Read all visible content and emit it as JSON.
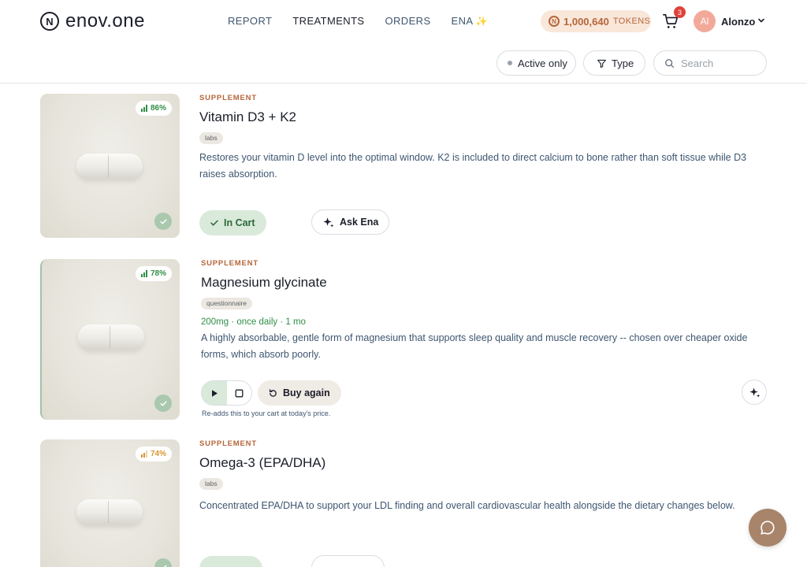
{
  "header": {
    "logo_text": "enov.one",
    "nav": [
      "REPORT",
      "TREATMENTS",
      "ORDERS",
      "ENA"
    ],
    "nav_active": "TREATMENTS",
    "tokens_amount": "1,000,640",
    "tokens_unit": "TOKENS",
    "cart_count": "3",
    "user_initials": "Al",
    "user_name": "Alonzo"
  },
  "filters": {
    "active_only": "Active only",
    "type": "Type",
    "search_placeholder": "Search"
  },
  "cards": [
    {
      "category": "SUPPLEMENT",
      "title": "Vitamin D3 + K2",
      "tag": "labs",
      "score": "86%",
      "score_color": "#2f8f47",
      "description": "Restores your vitamin D level into the optimal window. K2 is included to direct calcium to bone rather than soft tissue while D3 raises absorption.",
      "primary_action": "In Cart",
      "secondary_action": "Ask Ena"
    },
    {
      "category": "SUPPLEMENT",
      "title": "Magnesium glycinate",
      "tag": "questionnaire",
      "score": "78%",
      "score_color": "#2f8f47",
      "dosage": "200mg · once daily · 1 mo",
      "description": "A highly absorbable, gentle form of magnesium that supports sleep quality and muscle recovery -- chosen over cheaper oxide forms, which absorb poorly.",
      "primary_action": "Buy again",
      "hint": "Re-adds this to your cart at today's price."
    },
    {
      "category": "SUPPLEMENT",
      "title": "Omega-3 (EPA/DHA)",
      "tag": "labs",
      "score": "74%",
      "score_color": "#d9962c",
      "description": "Concentrated EPA/DHA to support your LDL finding and overall cardiovascular health alongside the dietary changes below."
    }
  ]
}
